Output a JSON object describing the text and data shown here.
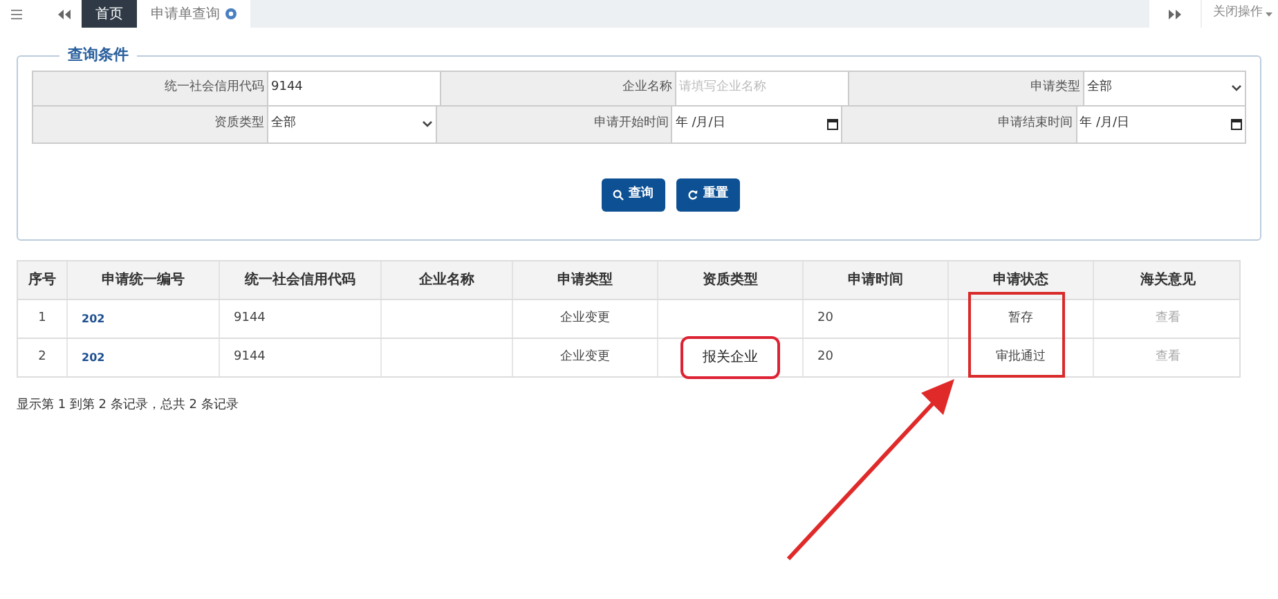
{
  "tabs": [
    {
      "label": "首页",
      "selected": true,
      "closable": false
    },
    {
      "label": "申请单查询",
      "selected": false,
      "closable": true
    }
  ],
  "close_menu": {
    "label": "关闭操作"
  },
  "query": {
    "legend": "查询条件",
    "fields": [
      {
        "kind": "text",
        "label": "统一社会信用代码",
        "value": "9144"
      },
      {
        "kind": "text",
        "label": "企业名称",
        "placeholder": "请填写企业名称"
      },
      {
        "kind": "select",
        "label": "申请类型",
        "value": "全部"
      },
      {
        "kind": "select",
        "label": "资质类型",
        "value": "全部"
      },
      {
        "kind": "date",
        "label": "申请开始时间",
        "value": "年 /月/日"
      },
      {
        "kind": "date",
        "label": "申请结束时间",
        "value": "年 /月/日"
      }
    ],
    "buttons": [
      {
        "kind": "search",
        "label": "查询"
      },
      {
        "kind": "reset",
        "label": "重置"
      }
    ]
  },
  "table": {
    "columns": [
      "序号",
      "申请统一编号",
      "统一社会信用代码",
      "企业名称",
      "申请类型",
      "资质类型",
      "申请时间",
      "申请状态",
      "海关意见"
    ],
    "rows": [
      {
        "cells": [
          "1",
          "202",
          "9144",
          "",
          "企业变更",
          "",
          "20",
          "暂存",
          "查看"
        ],
        "circled": false
      },
      {
        "cells": [
          "2",
          "202",
          "9144",
          "",
          "企业变更",
          "报关企业",
          "20",
          "审批通过",
          "查看"
        ],
        "circled": true
      }
    ]
  },
  "footer": "显示第 1 到第 2 条记录，总共 2 条记录"
}
